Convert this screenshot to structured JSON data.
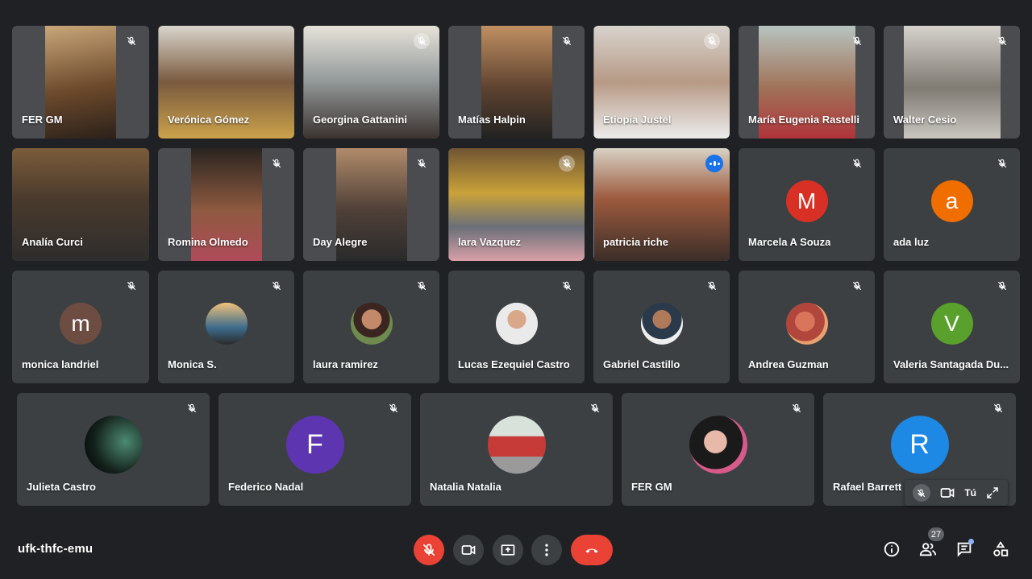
{
  "participants_row1": [
    {
      "name": "FER GM"
    },
    {
      "name": "Verónica Gómez"
    },
    {
      "name": "Georgina Gattanini"
    },
    {
      "name": "Matías Halpin"
    },
    {
      "name": "Etiopia Justel"
    },
    {
      "name": "María Eugenia Rastelli"
    },
    {
      "name": "Walter Cesio"
    }
  ],
  "participants_row2": [
    {
      "name": "Analía Curci"
    },
    {
      "name": "Romina Olmedo"
    },
    {
      "name": "Day Alegre"
    },
    {
      "name": "lara Vazquez"
    },
    {
      "name": "patricia riche"
    },
    {
      "name": "Marcela A Souza",
      "initial": "M",
      "color": "#d93025"
    },
    {
      "name": "ada luz",
      "initial": "a",
      "color": "#f06d00"
    }
  ],
  "participants_row3": [
    {
      "name": "monica landriel",
      "initial": "m",
      "color": "#6d4c41"
    },
    {
      "name": "Monica S."
    },
    {
      "name": "laura ramirez"
    },
    {
      "name": "Lucas Ezequiel Castro"
    },
    {
      "name": "Gabriel Castillo"
    },
    {
      "name": "Andrea Guzman"
    },
    {
      "name": "Valeria Santagada Du...",
      "initial": "V",
      "color": "#5aa02c"
    }
  ],
  "participants_row4": [
    {
      "name": "Julieta Castro"
    },
    {
      "name": "Federico Nadal",
      "initial": "F",
      "color": "#5e35b1"
    },
    {
      "name": "Natalia Natalia"
    },
    {
      "name": "FER GM"
    },
    {
      "name": "Rafael Barrett",
      "initial": "R",
      "color": "#1e88e5"
    }
  ],
  "self_view": {
    "label": "Tú"
  },
  "meeting": {
    "code": "ufk-thfc-emu"
  },
  "people_count": "27",
  "colors": {
    "background": "#202124",
    "tile": "#3c4043",
    "end_call": "#ea4335",
    "active_outline": "#8ab4f8"
  }
}
